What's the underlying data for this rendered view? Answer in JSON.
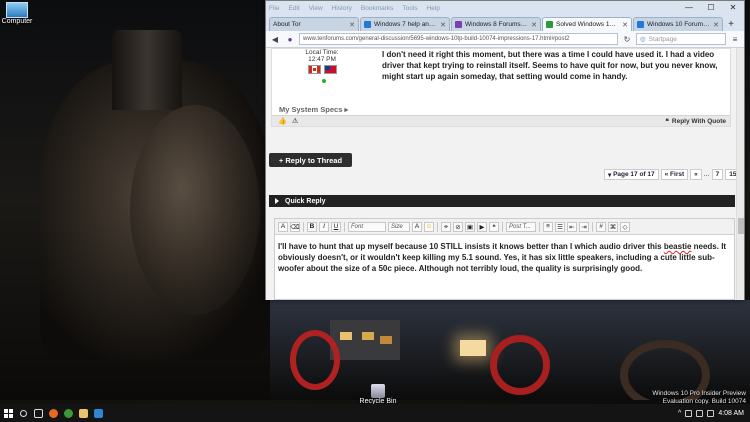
{
  "desktop": {
    "icons": [
      {
        "label": "Computer"
      },
      {
        "label": "Recycle Bin"
      }
    ],
    "watermark": {
      "line1": "Windows 10 Pro Insider Preview",
      "line2": "Evaluation copy. Build 10074"
    }
  },
  "taskbar": {
    "clock": "4:08 AM",
    "items": [
      "start",
      "search",
      "task-view",
      "firefox",
      "browser",
      "file-explorer",
      "photos"
    ]
  },
  "browser": {
    "menu": [
      "File",
      "Edit",
      "View",
      "History",
      "Bookmarks",
      "Tools",
      "Help"
    ],
    "tabs": [
      {
        "label": "About Tor",
        "color": "#f4f4f4",
        "active": false
      },
      {
        "label": "Windows 7 help and ...",
        "color": "#1e7ad6",
        "active": false
      },
      {
        "label": "Windows 8 Forums - ...",
        "color": "#7a3fb0",
        "active": false
      },
      {
        "label": "Solved Windows 10T...",
        "color": "#2a9a3a",
        "active": true
      },
      {
        "label": "Windows 10 Forums - ...",
        "color": "#1e7ad6",
        "active": false
      }
    ],
    "url": "www.tenforums.com/general-discussion/5695-windows-10tp-build-10074-impressions-17.html#post2",
    "search_placeholder": "Startpage",
    "controls": {
      "minimize": "—",
      "maximize": "☐",
      "close": "✕"
    }
  },
  "post": {
    "local_time": "Local Time: 12:47 PM",
    "specs_label": "My System Specs",
    "text": "I don't need it right this moment, but there was a time I could have used it. I had a video driver that kept trying to reinstall itself. Seems to have quit for now, but you never know, might start up again someday, that setting would come in handy.",
    "reply_with_quote": "Reply With Quote"
  },
  "reply_to_thread": "+ Reply to Thread",
  "pagination": {
    "page_of": "Page 17 of 17",
    "first": "« First",
    "prev": "«",
    "dots": "...",
    "pages": [
      "7",
      "15"
    ]
  },
  "quick_reply": {
    "title": "Quick Reply",
    "font_label": "Font",
    "size_label": "Size",
    "post_label": "Post T...",
    "text_before": "I'll have to hunt that up myself because 10 STILL insists it knows better than I which audio driver this ",
    "text_misspelled": "beastie",
    "text_after": " needs. It obviously doesn't, or it wouldn't keep killing my 5.1 sound. Yes, it has six little speakers, including a cute little sub-woofer about the size of a 50c piece. Although not terribly loud, the quality is surprisingly good."
  }
}
